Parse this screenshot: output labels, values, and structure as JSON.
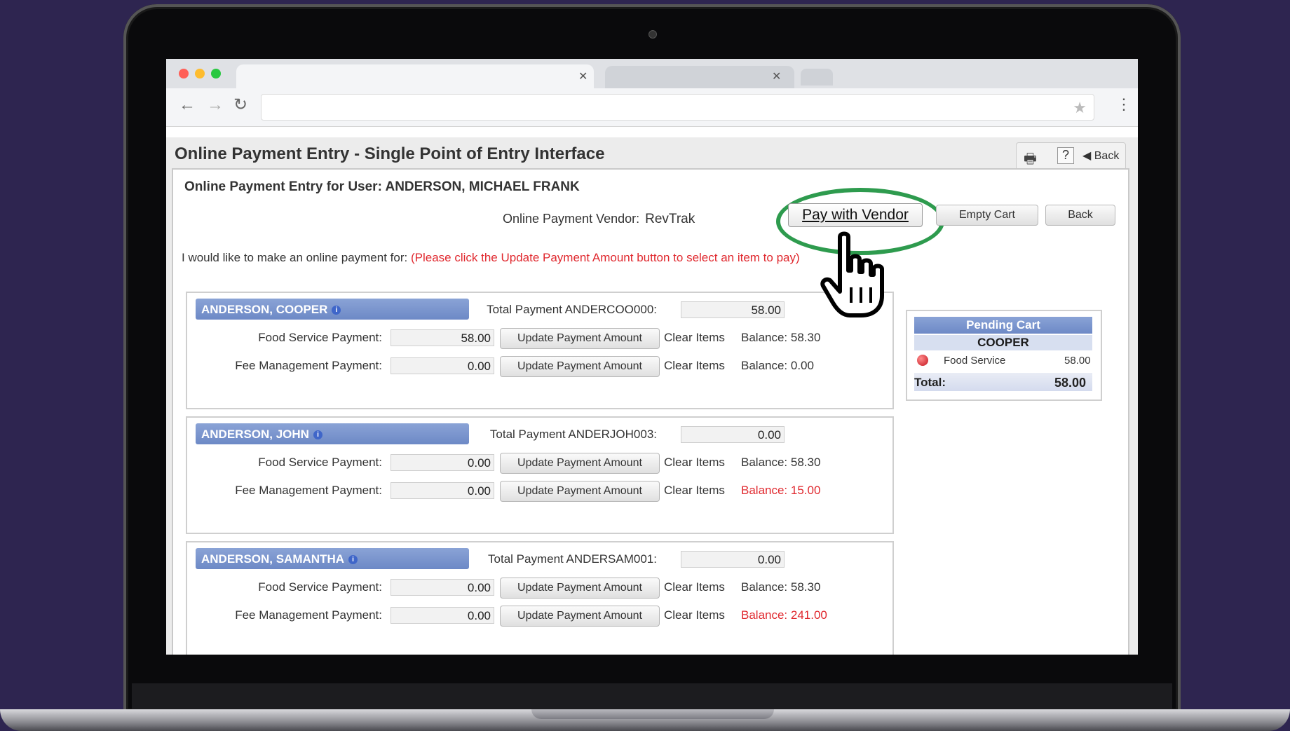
{
  "page": {
    "title": "Online Payment Entry - Single Point of Entry Interface",
    "header_back": "◀ Back",
    "help": "?",
    "user_line": "Online Payment Entry for User: ANDERSON, MICHAEL FRANK",
    "vendor_label": "Online Payment Vendor:",
    "vendor_value": "RevTrak",
    "pay_button": "Pay with Vendor",
    "empty_cart_button": "Empty Cart",
    "back_button": "Back",
    "intro_text": "I would like to make an online payment for:",
    "intro_note": "(Please click the Update Payment Amount button to select an item to pay)"
  },
  "students": [
    {
      "name": "ANDERSON, COOPER",
      "total_label": "Total Payment ANDERCOO000:",
      "total_value": "58.00",
      "rows": [
        {
          "label": "Food Service Payment:",
          "amount": "58.00",
          "button": "Update Payment Amount",
          "clear": "Clear Items",
          "balance": "Balance: 58.30",
          "balance_color": "#333333"
        },
        {
          "label": "Fee Management Payment:",
          "amount": "0.00",
          "button": "Update Payment Amount",
          "clear": "Clear Items",
          "balance": "Balance: 0.00",
          "balance_color": "#333333"
        }
      ]
    },
    {
      "name": "ANDERSON, JOHN",
      "total_label": "Total Payment ANDERJOH003:",
      "total_value": "0.00",
      "rows": [
        {
          "label": "Food Service Payment:",
          "amount": "0.00",
          "button": "Update Payment Amount",
          "clear": "Clear Items",
          "balance": "Balance: 58.30",
          "balance_color": "#333333"
        },
        {
          "label": "Fee Management Payment:",
          "amount": "0.00",
          "button": "Update Payment Amount",
          "clear": "Clear Items",
          "balance": "Balance: 15.00",
          "balance_color": "#e0282e"
        }
      ]
    },
    {
      "name": "ANDERSON, SAMANTHA",
      "total_label": "Total Payment ANDERSAM001:",
      "total_value": "0.00",
      "rows": [
        {
          "label": "Food Service Payment:",
          "amount": "0.00",
          "button": "Update Payment Amount",
          "clear": "Clear Items",
          "balance": "Balance: 58.30",
          "balance_color": "#333333"
        },
        {
          "label": "Fee Management Payment:",
          "amount": "0.00",
          "button": "Update Payment Amount",
          "clear": "Clear Items",
          "balance": "Balance: 241.00",
          "balance_color": "#e0282e"
        }
      ]
    }
  ],
  "cart": {
    "title": "Pending Cart",
    "student": "COOPER",
    "item_name": "Food Service",
    "item_amount": "58.00",
    "total_label": "Total:",
    "total_value": "58.00"
  },
  "icons": {
    "print": "printer-icon",
    "help": "help-icon",
    "back": "back-icon",
    "cursor": "hand-pointer-icon"
  },
  "colors": {
    "highlight_ring": "#2e9b4e",
    "name_bar": "#6d89c6",
    "warning_text": "#e0282e"
  }
}
